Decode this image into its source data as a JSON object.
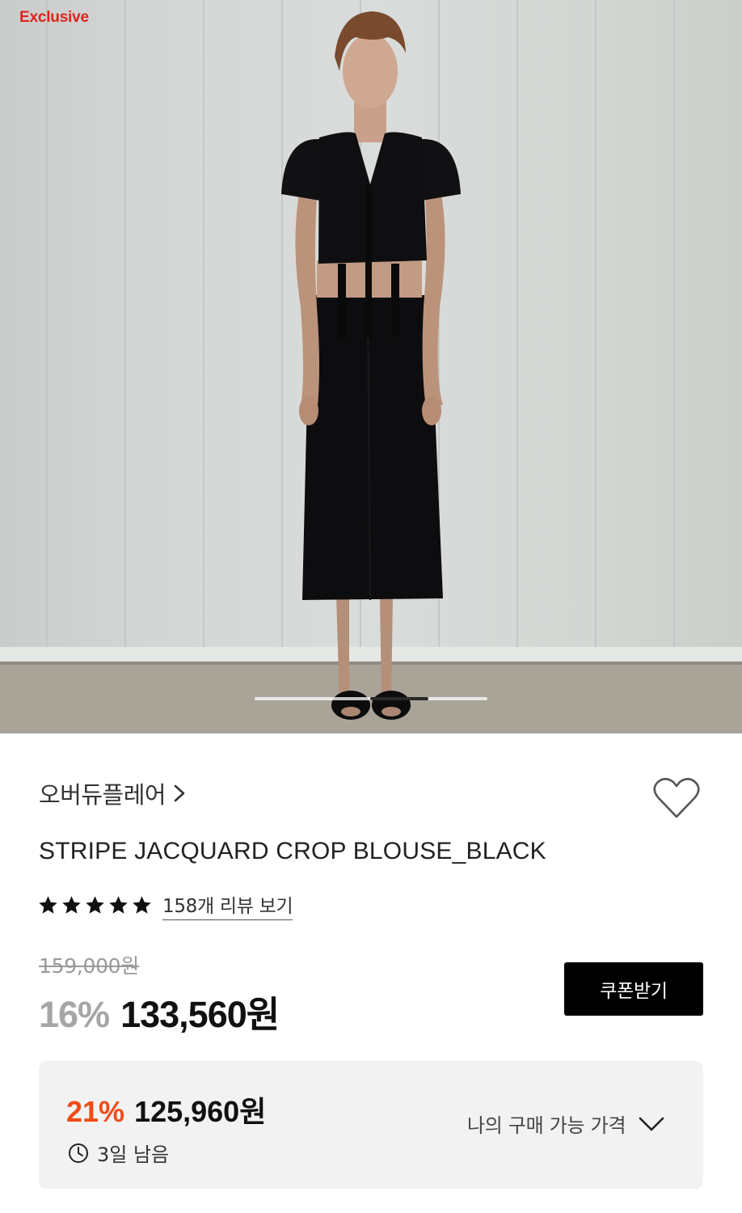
{
  "hero": {
    "badge": "Exclusive",
    "carousel": {
      "current_index": 3,
      "total": 5
    },
    "image_alt": "model-photo"
  },
  "product": {
    "brand": "오버듀플레어",
    "brand_chevron": "chevron-right-icon",
    "title": "STRIPE JACQUARD CROP BLOUSE_BLACK",
    "rating_stars": 5,
    "review_link": "158개 리뷰 보기",
    "original_price": "159,000원",
    "discount_rate": "16%",
    "sale_price": "133,560원",
    "coupon_button": "쿠폰받기",
    "wishlist_icon": "heart-outline-icon"
  },
  "best_price": {
    "discount_rate": "21%",
    "price": "125,960원",
    "time_left": "3일 남음",
    "toggle_label": "나의 구매 가능 가격",
    "toggle_icon": "chevron-down-icon"
  },
  "colors": {
    "badge_red": "#e0241b",
    "discount_orange": "#f04b16",
    "muted_gray": "#a6a6a6",
    "box_bg": "#f2f2f2",
    "button_black": "#000000"
  }
}
